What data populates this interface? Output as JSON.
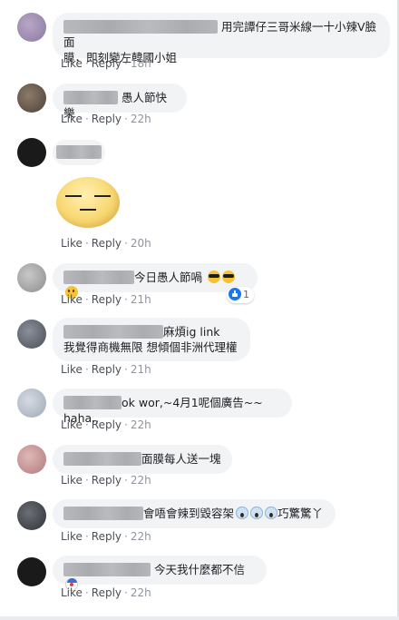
{
  "actions": {
    "like": "Like",
    "reply": "Reply",
    "sep": "·"
  },
  "comments": [
    {
      "text_line1": "用完譚仔三哥米線一十小辣V臉面",
      "text_line2": "膜，即刻變左韓國小姐",
      "time": "18h"
    },
    {
      "text": "愚人節快樂",
      "time": "22h"
    },
    {
      "sticker": "expressionless-face-sticker",
      "time": "20h"
    },
    {
      "text": "今日愚人節喎",
      "emojis": [
        "sunglasses-emoji",
        "sunglasses-emoji",
        "thinking-emoji"
      ],
      "reaction_count": "1",
      "time": "21h"
    },
    {
      "text_line1": "麻煩ig link",
      "text_line2": "我覺得商機無限 想傾個非洲代理權",
      "time": "21h"
    },
    {
      "text": "ok wor,~4月1呢個廣告~~ haha,,",
      "time": "22h"
    },
    {
      "text": "面膜每人送一塊",
      "time": "22h"
    },
    {
      "text": "會唔會辣到毀容架",
      "emojis": [
        "scream-emoji",
        "scream-emoji",
        "scream-emoji"
      ],
      "text_after": "巧驚驚丫",
      "time": "22h"
    },
    {
      "text": "今天我什麼都不信",
      "emojis": [
        "clown-emoji"
      ],
      "time": "22h"
    }
  ],
  "colors": {
    "bubble": "#f2f3f5",
    "meta": "#616770",
    "like_blue": "#1877f2",
    "sticker": "#f8d873"
  }
}
